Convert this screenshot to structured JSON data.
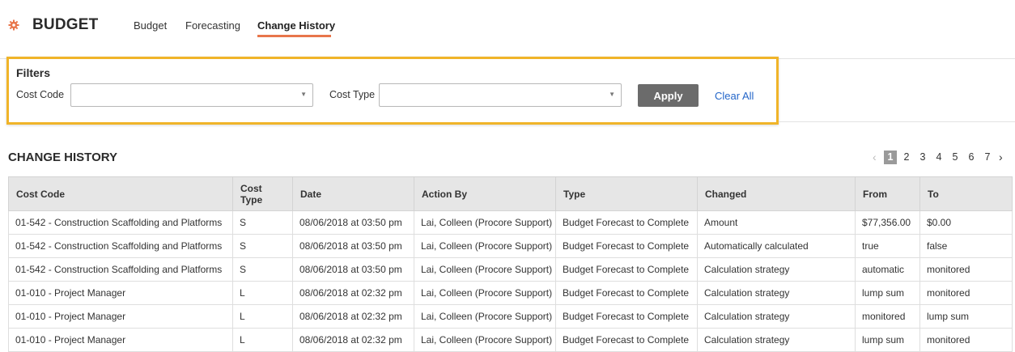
{
  "app": {
    "title": "BUDGET"
  },
  "nav": {
    "tabs": [
      {
        "label": "Budget"
      },
      {
        "label": "Forecasting"
      },
      {
        "label": "Change History"
      }
    ],
    "active_color": "#e8764b"
  },
  "filters": {
    "title": "Filters",
    "cost_code_label": "Cost Code",
    "cost_code_value": "",
    "cost_type_label": "Cost Type",
    "cost_type_value": "",
    "apply_label": "Apply",
    "clear_label": "Clear All",
    "highlight_color": "#f0b429"
  },
  "change_history": {
    "title": "CHANGE HISTORY",
    "pagination": {
      "pages": [
        "1",
        "2",
        "3",
        "4",
        "5",
        "6",
        "7"
      ],
      "current": "1"
    },
    "columns": [
      "Cost Code",
      "Cost Type",
      "Date",
      "Action By",
      "Type",
      "Changed",
      "From",
      "To"
    ],
    "rows": [
      [
        "01-542 - Construction Scaffolding and Platforms",
        "S",
        "08/06/2018 at 03:50 pm",
        "Lai, Colleen (Procore Support)",
        "Budget Forecast to Complete",
        "Amount",
        "$77,356.00",
        "$0.00"
      ],
      [
        "01-542 - Construction Scaffolding and Platforms",
        "S",
        "08/06/2018 at 03:50 pm",
        "Lai, Colleen (Procore Support)",
        "Budget Forecast to Complete",
        "Automatically calculated",
        "true",
        "false"
      ],
      [
        "01-542 - Construction Scaffolding and Platforms",
        "S",
        "08/06/2018 at 03:50 pm",
        "Lai, Colleen (Procore Support)",
        "Budget Forecast to Complete",
        "Calculation strategy",
        "automatic",
        "monitored"
      ],
      [
        "01-010 - Project Manager",
        "L",
        "08/06/2018 at 02:32 pm",
        "Lai, Colleen (Procore Support)",
        "Budget Forecast to Complete",
        "Calculation strategy",
        "lump sum",
        "monitored"
      ],
      [
        "01-010 - Project Manager",
        "L",
        "08/06/2018 at 02:32 pm",
        "Lai, Colleen (Procore Support)",
        "Budget Forecast to Complete",
        "Calculation strategy",
        "monitored",
        "lump sum"
      ],
      [
        "01-010 - Project Manager",
        "L",
        "08/06/2018 at 02:32 pm",
        "Lai, Colleen (Procore Support)",
        "Budget Forecast to Complete",
        "Calculation strategy",
        "lump sum",
        "monitored"
      ]
    ]
  },
  "icons": {
    "gear": "gear-icon",
    "dropdown": "chevron-down-icon",
    "prev": "chevron-left-icon",
    "next": "chevron-right-icon"
  }
}
